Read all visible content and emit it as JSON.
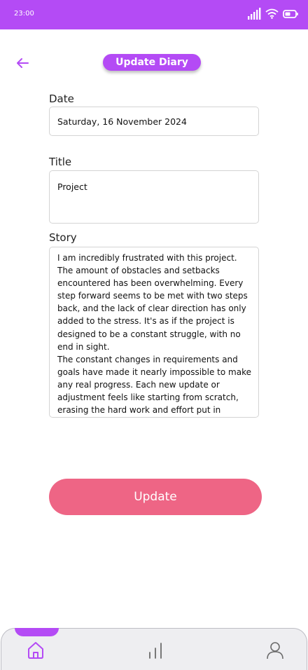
{
  "status_bar": {
    "time": "23:00",
    "icons": [
      "signal-icon",
      "wifi-icon",
      "battery-icon"
    ]
  },
  "header": {
    "back_icon": "arrow-left-icon",
    "title": "Update Diary"
  },
  "form": {
    "date": {
      "label": "Date",
      "value": "Saturday, 16 November 2024"
    },
    "title": {
      "label": "Title",
      "value": "Project"
    },
    "story": {
      "label": "Story",
      "value": "I am incredibly frustrated with this project. The amount of obstacles and setbacks encountered has been overwhelming. Every step forward seems to be met with two steps back, and the lack of clear direction has only added to the stress. It's as if the project is designed to be a constant struggle, with no end in sight.\nThe constant changes in requirements and goals have made it nearly impossible to make any real progress. Each new update or adjustment feels like starting from scratch, erasing the hard work and effort put in"
    },
    "submit_label": "Update"
  },
  "bottom_nav": {
    "items": [
      {
        "icon": "home-icon",
        "active": true
      },
      {
        "icon": "bar-chart-icon",
        "active": false
      },
      {
        "icon": "user-icon",
        "active": false
      }
    ]
  },
  "colors": {
    "primary": "#b44bf5",
    "button": "#ee6585",
    "nav_background": "#eeeef1"
  }
}
